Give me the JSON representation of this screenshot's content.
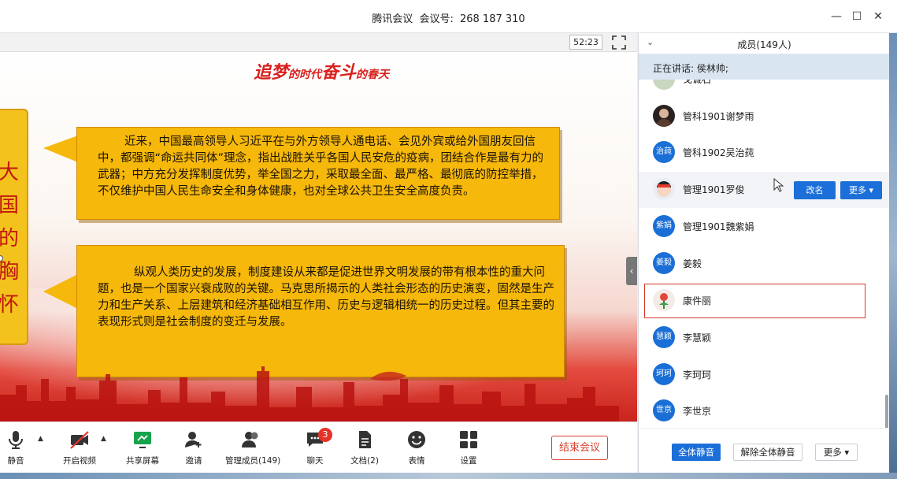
{
  "window": {
    "app_name": "腾讯会议",
    "meeting_label": "会议号:",
    "meeting_id": "268 187 310",
    "minimize": "—",
    "maximize": "☐",
    "close": "✕"
  },
  "share": {
    "timer": "52:23",
    "slide": {
      "title_a": "追梦",
      "title_b": "的时代",
      "title_c": "奋斗",
      "title_d": "的春天",
      "left_card_text": "大国的胸怀",
      "paragraph1": "近来，中国最高领导人习近平在与外方领导人通电话、会见外宾或给外国朋友回信中，都强调“命运共同体”理念，指出战胜关乎各国人民安危的疫病，团结合作是最有力的武器；中方充分发挥制度优势，举全国之力，采取最全面、最严格、最彻底的防控举措，不仅维护中国人民生命安全和身体健康，也对全球公共卫生安全高度负责。",
      "paragraph2": "纵观人类历史的发展，制度建设从来都是促进世界文明发展的带有根本性的重大问题，也是一个国家兴衰成败的关键。马克思所揭示的人类社会形态的历史演变，固然是生产力和生产关系、上层建筑和经济基础相互作用、历史与逻辑相统一的历史过程。但其主要的表现形式则是社会制度的变迁与发展。"
    }
  },
  "toolbar": {
    "mute": "静音",
    "video": "开启视频",
    "share_screen": "共享屏幕",
    "invite": "邀请",
    "manage_members": "管理成员(149)",
    "chat": "聊天",
    "chat_badge": "3",
    "docs": "文档(2)",
    "emoji": "表情",
    "settings": "设置",
    "end_meeting": "结束会议"
  },
  "members_panel": {
    "header": "成员(149人)",
    "speaking": "正在讲话: 侯林帅;",
    "members": [
      {
        "name": "戈诚石",
        "avatar_text": ""
      },
      {
        "name": "管科1901谢梦雨",
        "avatar_text": ""
      },
      {
        "name": "管科1902吴治莼",
        "avatar_text": "治莼"
      },
      {
        "name": "管理1901罗俊",
        "avatar_text": ""
      },
      {
        "name": "管理1901魏紫娟",
        "avatar_text": "紫娟"
      },
      {
        "name": "姜毅",
        "avatar_text": "姜毅"
      },
      {
        "name": "康件丽",
        "avatar_text": ""
      },
      {
        "name": "李慧颖",
        "avatar_text": "慧颖"
      },
      {
        "name": "李珂珂",
        "avatar_text": "珂珂"
      },
      {
        "name": "李世京",
        "avatar_text": "世京"
      }
    ],
    "rename_label": "改名",
    "more_label": "更多 ▾",
    "mute_all": "全体静音",
    "unmute_all": "解除全体静音",
    "footer_more": "更多 ▾"
  },
  "colors": {
    "accent_blue": "#1c6fd8",
    "end_red": "#d9402f",
    "slide_gold": "#f6b80a"
  }
}
